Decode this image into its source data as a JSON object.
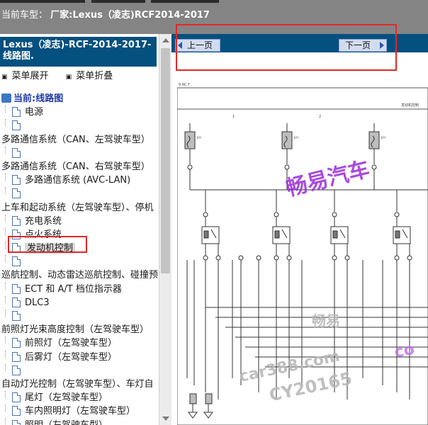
{
  "header": {
    "prefix": "当前车型：",
    "vehicle": "厂家:Lexus（凌志)RCF2014-2017"
  },
  "sidebar": {
    "title": "Lexus（凌志)-RCF-2014-2017- 线路图.",
    "expand_label": "菜单展开",
    "collapse_label": "菜单折叠",
    "root_label": "当前:线路图",
    "items": [
      {
        "label": "电源",
        "level": 1,
        "doc": true
      },
      {
        "label": "",
        "level": 1,
        "doc": true
      },
      {
        "label": "多路通信系统（CAN、左驾驶车型）",
        "level": 0,
        "doc": false
      },
      {
        "label": "",
        "level": 1,
        "doc": true
      },
      {
        "label": "多路通信系统（CAN、右驾驶车型）",
        "level": 0,
        "doc": false
      },
      {
        "label": "多路通信系统 (AVC-LAN)",
        "level": 1,
        "doc": true
      },
      {
        "label": "",
        "level": 1,
        "doc": true
      },
      {
        "label": "上车和起动系统（左驾驶车型）、停机",
        "level": 0,
        "doc": false
      },
      {
        "label": "充电系统",
        "level": 1,
        "doc": true
      },
      {
        "label": "点火系统",
        "level": 1,
        "doc": true
      },
      {
        "label": "发动机控制",
        "level": 1,
        "doc": true,
        "selected": true
      },
      {
        "label": "",
        "level": 1,
        "doc": true
      },
      {
        "label": "巡航控制、动态雷达巡航控制、碰撞预",
        "level": 0,
        "doc": false
      },
      {
        "label": "ECT 和 A/T 档位指示器",
        "level": 1,
        "doc": true
      },
      {
        "label": "DLC3",
        "level": 1,
        "doc": true
      },
      {
        "label": "",
        "level": 1,
        "doc": true
      },
      {
        "label": "前照灯光束高度控制（左驾驶车型）",
        "level": 0,
        "doc": false
      },
      {
        "label": "前照灯（左驾驶车型）",
        "level": 1,
        "doc": true
      },
      {
        "label": "后雾灯（左驾驶车型）",
        "level": 1,
        "doc": true
      },
      {
        "label": "",
        "level": 1,
        "doc": true
      },
      {
        "label": "自动灯光控制（左驾驶车型）、车灯自",
        "level": 0,
        "doc": false
      },
      {
        "label": "尾灯（左驾驶车型）",
        "level": 1,
        "doc": true
      },
      {
        "label": "车内照明灯（左驾驶车型）",
        "level": 1,
        "doc": true
      },
      {
        "label": "照明（左驾驶车型）",
        "level": 1,
        "doc": true
      }
    ]
  },
  "nav": {
    "prev_label": "上一页",
    "next_label": "下一页"
  },
  "diagram": {
    "page_ref": "9  RC F",
    "section_title": "发动机控制",
    "column_markers": [
      "1",
      "2"
    ],
    "fuse_labels": [
      "EFI",
      "EFI",
      "EFI"
    ],
    "watermarks": [
      "畅易汽车",
      "畅易",
      "car388.com",
      "CY20165",
      "co"
    ]
  },
  "colors": {
    "header_gray": "#848484",
    "nav_blue": "#04507f",
    "highlight_red": "#e02828",
    "watermark_purple": "#9a2bd8"
  }
}
